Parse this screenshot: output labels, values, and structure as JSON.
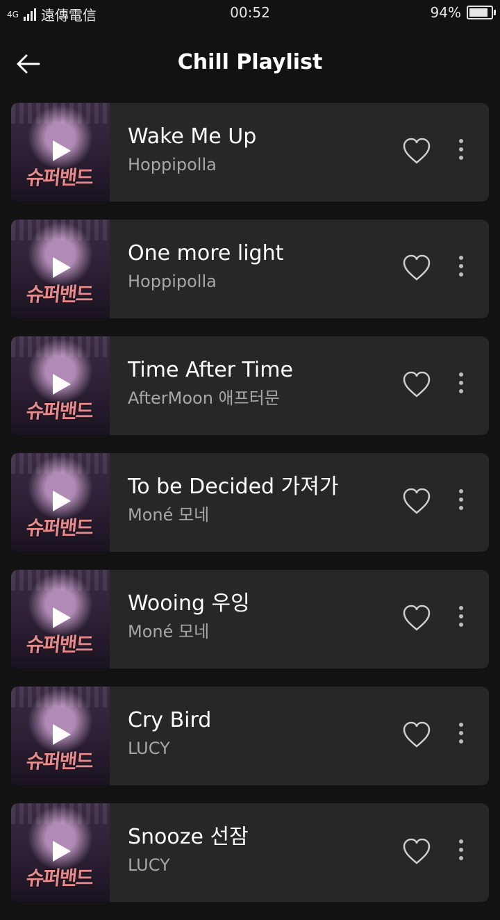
{
  "status_bar": {
    "signal_text": "4G",
    "carrier": "遠傳電信",
    "time": "00:52",
    "battery_percent": "94%",
    "battery_level": 0.94
  },
  "header": {
    "back_icon": "arrow-left-icon",
    "title": "Chill Playlist"
  },
  "playlist": [
    {
      "song": "Wake Me Up",
      "artist": "Hoppipolla"
    },
    {
      "song": "One more light",
      "artist": "Hoppipolla"
    },
    {
      "song": "Time After Time",
      "artist": "AfterMoon 애프터문"
    },
    {
      "song": "To be Decided 가져가",
      "artist": "Moné 모네"
    },
    {
      "song": "Wooing 우잉",
      "artist": "Moné 모네"
    },
    {
      "song": "Cry Bird",
      "artist": "LUCY"
    },
    {
      "song": "Snooze 선잠",
      "artist": "LUCY"
    }
  ],
  "album_art_text": "슈퍼밴드",
  "icons": {
    "play": "play-icon",
    "heart": "heart-outline-icon",
    "more": "more-vertical-icon"
  }
}
